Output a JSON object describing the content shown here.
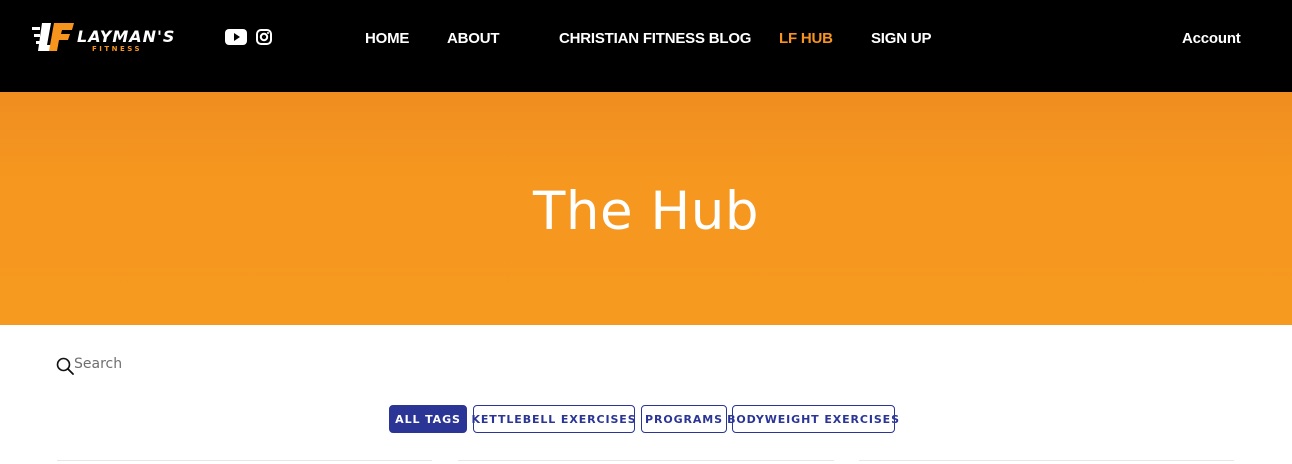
{
  "header": {
    "logo": {
      "main": "LAYMAN'S",
      "sub": "FITNESS",
      "mark": "LF"
    },
    "social": {
      "youtube": "youtube-icon",
      "instagram": "instagram-icon"
    },
    "nav": [
      {
        "label": "HOME"
      },
      {
        "label": "ABOUT"
      },
      {
        "label": "CHRISTIAN FITNESS BLOG"
      },
      {
        "label": "LF HUB"
      },
      {
        "label": "SIGN UP"
      }
    ],
    "account": "Account"
  },
  "hero": {
    "title": "The Hub"
  },
  "search": {
    "placeholder": "Search",
    "icon": "search-icon"
  },
  "tags": [
    {
      "label": "ALL TAGS"
    },
    {
      "label": "KETTLEBELL EXERCISES"
    },
    {
      "label": "PROGRAMS"
    },
    {
      "label": "BODYWEIGHT EXERCISES"
    }
  ],
  "colors": {
    "header_bg": "#000000",
    "accent": "#f7941d",
    "hero_bg": "#f6981f",
    "tag_blue": "#2b3595"
  }
}
